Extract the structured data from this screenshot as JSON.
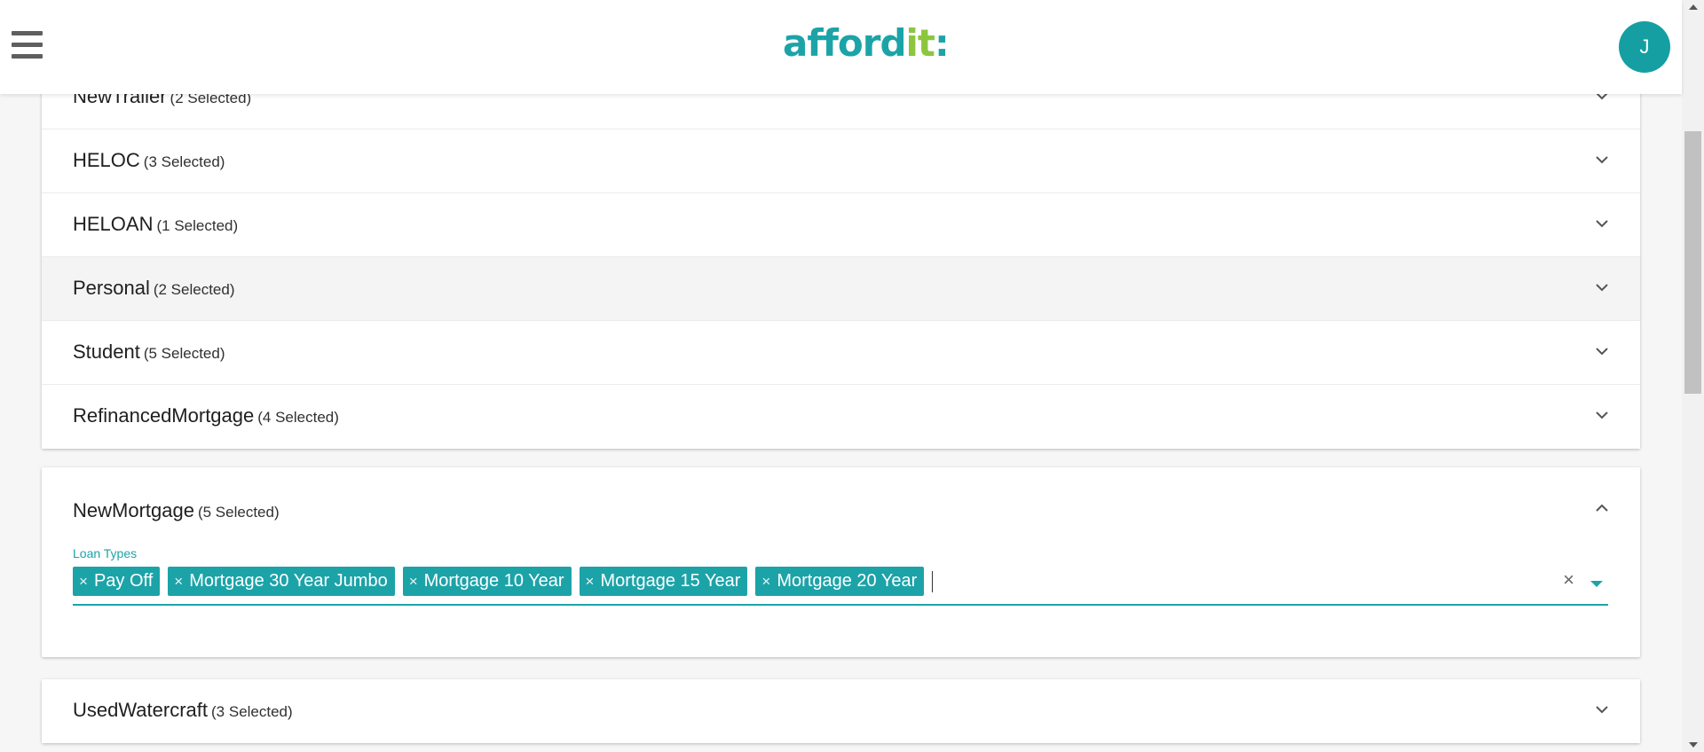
{
  "header": {
    "logo_main": "afford",
    "logo_accent": "it",
    "logo_dots": ":",
    "avatar_initial": "J"
  },
  "loan_categories": [
    {
      "name": "NewTrailer",
      "count": "(2 Selected)"
    },
    {
      "name": "HELOC",
      "count": "(3 Selected)"
    },
    {
      "name": "HELOAN",
      "count": "(1 Selected)"
    },
    {
      "name": "Personal",
      "count": "(2 Selected)"
    },
    {
      "name": "Student",
      "count": "(5 Selected)"
    },
    {
      "name": "RefinancedMortgage",
      "count": "(4 Selected)"
    }
  ],
  "expanded": {
    "name": "NewMortgage",
    "count": "(5 Selected)",
    "field_label": "Loan Types",
    "chips": [
      "Pay Off",
      "Mortgage 30 Year Jumbo",
      "Mortgage 10 Year",
      "Mortgage 15 Year",
      "Mortgage 20 Year"
    ],
    "chip_remove": "×",
    "clear_symbol": "×"
  },
  "next_category": {
    "name": "UsedWatercraft",
    "count": "(3 Selected)"
  },
  "colors": {
    "accent": "#1ca3a8",
    "logo_green": "#8cc63f",
    "avatar": "#159fa3"
  }
}
